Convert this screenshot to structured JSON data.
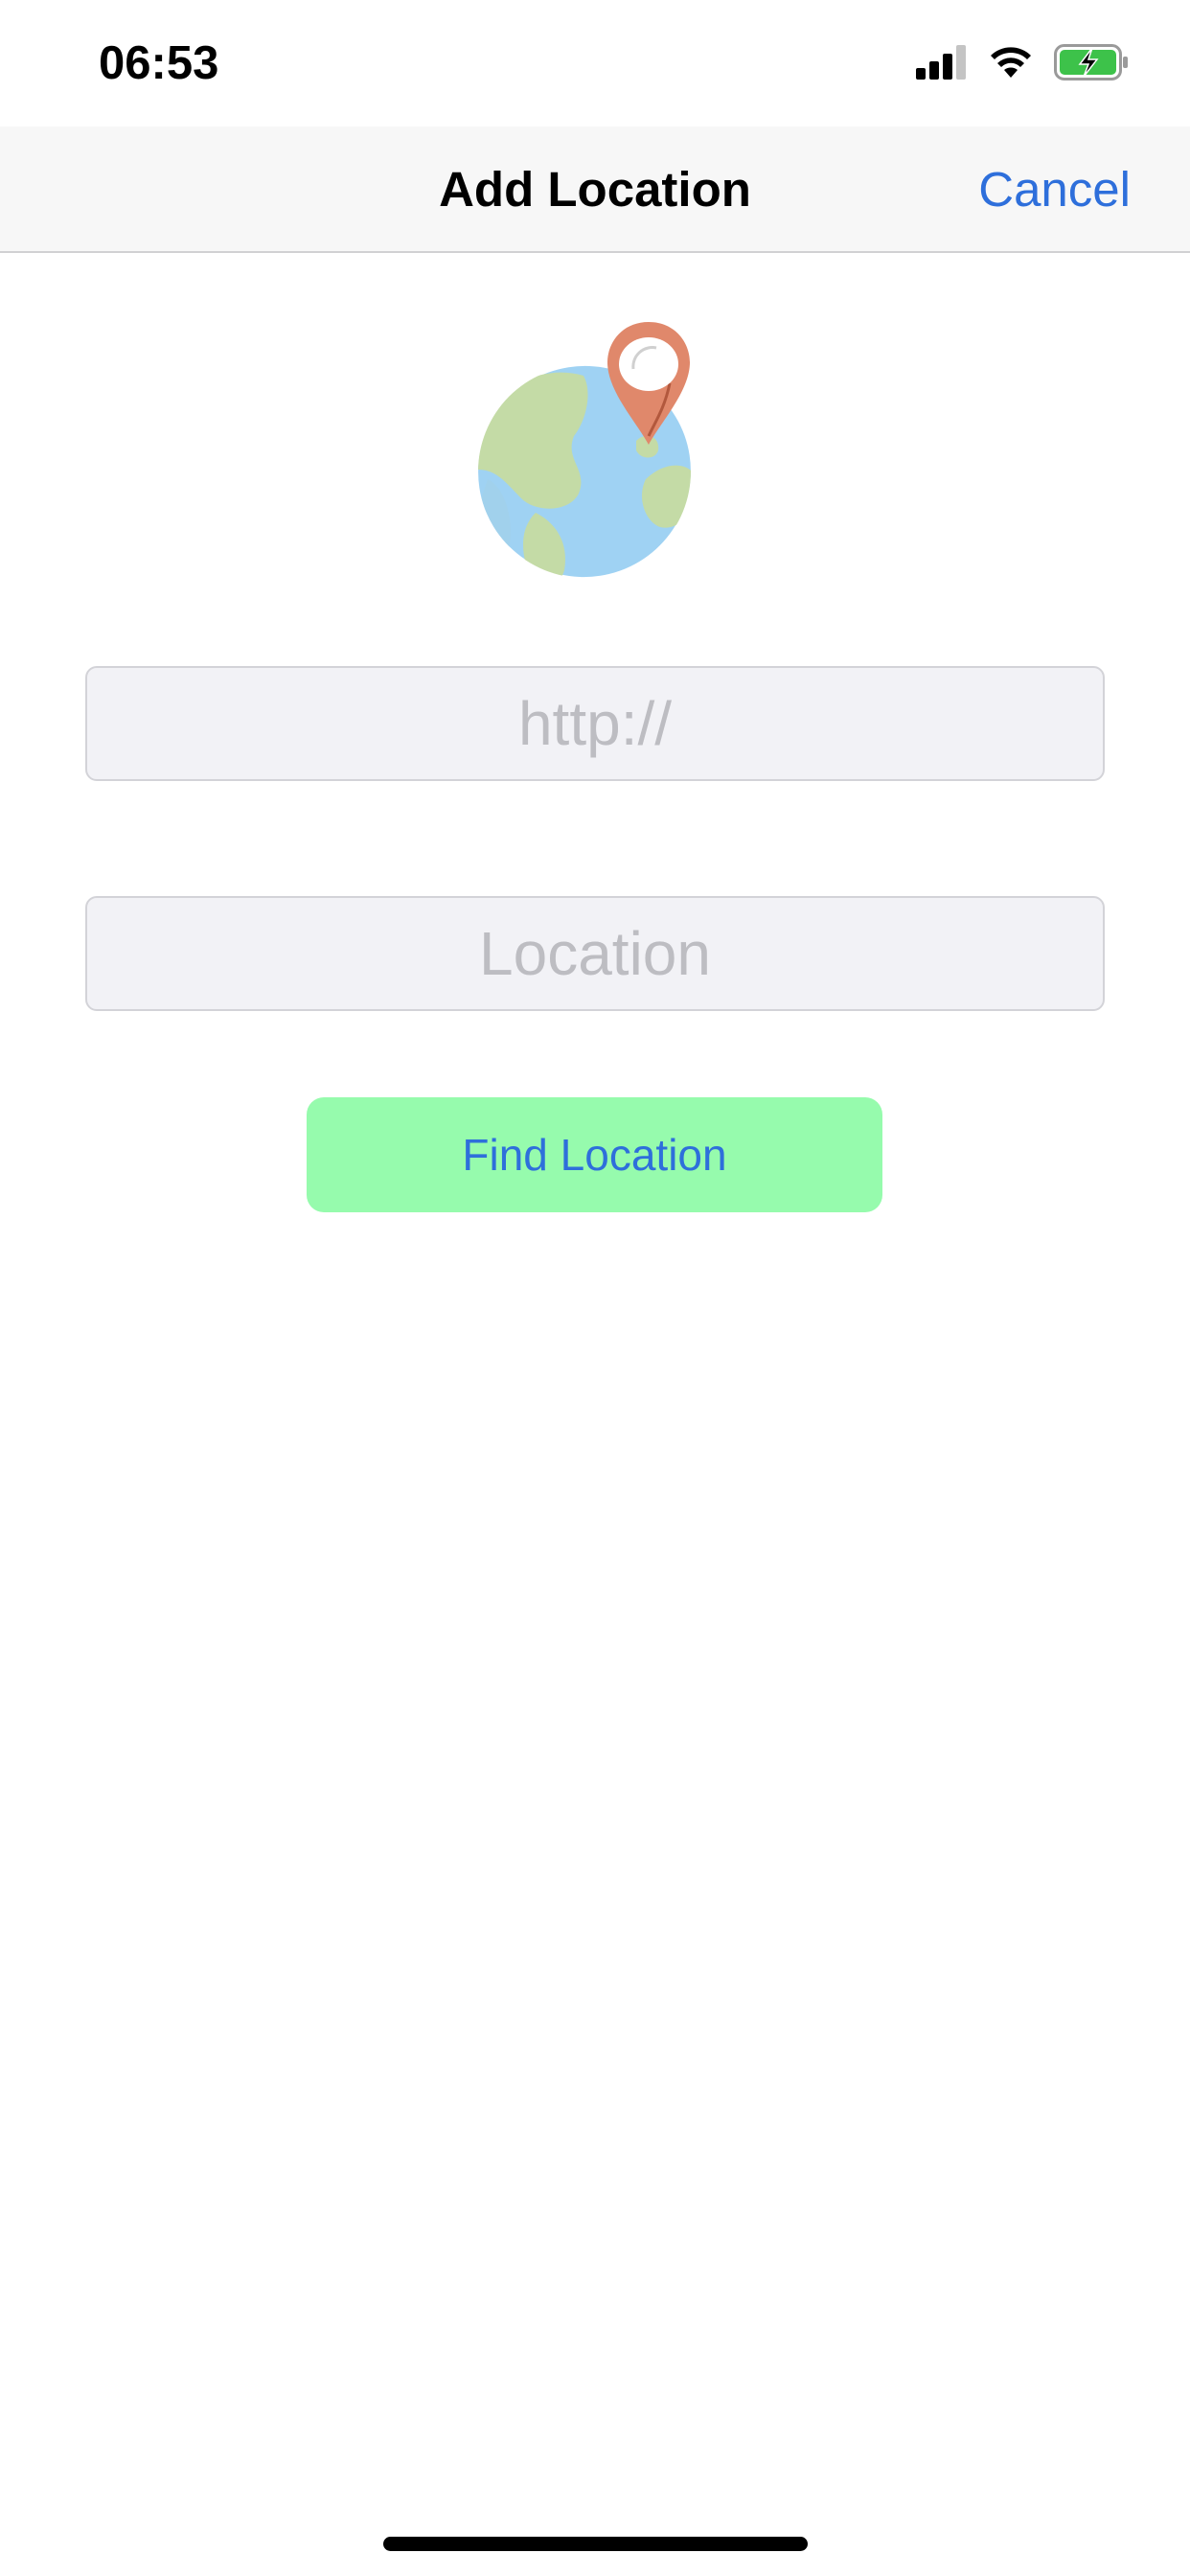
{
  "status_bar": {
    "time": "06:53",
    "signal_icon": "cellular-signal-icon",
    "wifi_icon": "wifi-icon",
    "battery_icon": "battery-charging-icon",
    "battery_color": "#3dc24a"
  },
  "nav_bar": {
    "title": "Add Location",
    "cancel_label": "Cancel"
  },
  "hero": {
    "icon": "globe-location-pin-icon"
  },
  "form": {
    "url_placeholder": "http://",
    "url_value": "",
    "location_placeholder": "Location",
    "location_value": "",
    "find_button_label": "Find Location"
  },
  "colors": {
    "accent": "#2e6fdb",
    "button_bg": "#96fbad",
    "field_bg": "#f2f2f6",
    "placeholder": "#bdbdc2",
    "pin": "#e0886b"
  }
}
